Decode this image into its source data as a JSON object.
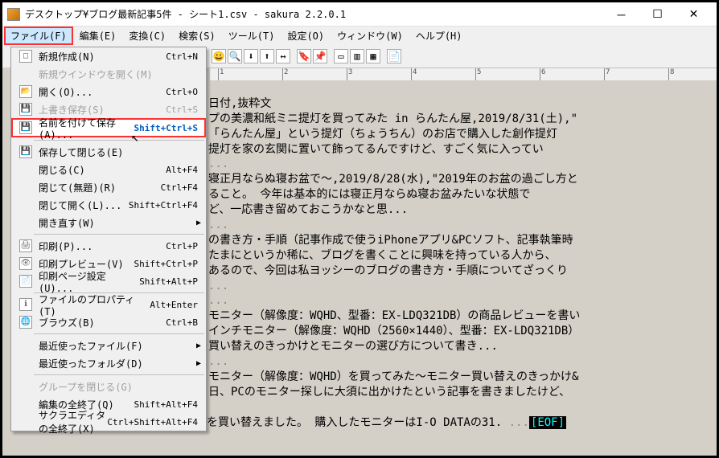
{
  "titlebar": {
    "text": "デスクトップ¥ブログ最新記事5件 - シート1.csv - sakura 2.2.0.1"
  },
  "menubar": {
    "file": "ファイル(F)",
    "edit": "編集(E)",
    "convert": "変換(C)",
    "search": "検索(S)",
    "tools": "ツール(T)",
    "settings": "設定(O)",
    "window": "ウィンドウ(W)",
    "help": "ヘルプ(H)"
  },
  "file_menu": {
    "new": {
      "label": "新規作成(N)",
      "shortcut": "Ctrl+N"
    },
    "new_window": {
      "label": "新規ウインドウを開く(M)"
    },
    "open": {
      "label": "開く(O)...",
      "shortcut": "Ctrl+O"
    },
    "save": {
      "label": "上書き保存(S)",
      "shortcut": "Ctrl+S"
    },
    "save_as": {
      "label": "名前を付けて保存(A)...",
      "shortcut": "Shift+Ctrl+S"
    },
    "save_close": {
      "label": "保存して閉じる(E)"
    },
    "close": {
      "label": "閉じる(C)",
      "shortcut": "Alt+F4"
    },
    "close_nosave": {
      "label": "閉じて(無題)(R)",
      "shortcut": "Ctrl+F4"
    },
    "close_open": {
      "label": "閉じて開く(L)...",
      "shortcut": "Shift+Ctrl+F4"
    },
    "reopen": {
      "label": "開き直す(W)"
    },
    "print": {
      "label": "印刷(P)...",
      "shortcut": "Ctrl+P"
    },
    "print_preview": {
      "label": "印刷プレビュー(V)",
      "shortcut": "Shift+Ctrl+P"
    },
    "page_setup": {
      "label": "印刷ページ設定(U)...",
      "shortcut": "Shift+Alt+P"
    },
    "properties": {
      "label": "ファイルのプロパティ(T)",
      "shortcut": "Alt+Enter"
    },
    "browse": {
      "label": "ブラウズ(B)",
      "shortcut": "Ctrl+B"
    },
    "recent_files": {
      "label": "最近使ったファイル(F)"
    },
    "recent_folders": {
      "label": "最近使ったフォルダ(D)"
    },
    "close_group": {
      "label": "グループを閉じる(G)"
    },
    "exit_editor": {
      "label": "編集の全終了(Q)",
      "shortcut": "Shift+Alt+F4"
    },
    "exit_all": {
      "label": "サクラエディタの全終了(X)",
      "shortcut": "Ctrl+Shift+Alt+F4"
    }
  },
  "editor_text": {
    "l1": "日付,抜粋文",
    "l2": "プの美濃和紙ミニ提灯を買ってみた in らんたん屋,2019/8/31(土),\"",
    "l3": "「らんたん屋」という提灯（ちょうちん）のお店で購入した創作提灯",
    "l4": "提灯を家の玄関に置いて飾ってるんですけど、すごく気に入ってい",
    "l5": "寝正月ならぬ寝お盆で～,2019/8/28(水),\"2019年のお盆の過ごし方と",
    "l6": "ること。 今年は基本的には寝正月ならぬ寝お盆みたいな状態で",
    "l7": "ど、一応書き留めておこうかなと思...",
    "l8": "の書き方・手順（記事作成で使うiPhoneアプリ&PCソフト、記事執筆時",
    "l9": "たまにというか稀に、ブログを書くことに興味を持っている人から、",
    "l10": "あるので、今回は私ヨッシーのブログの書き方・手順についてざっくり",
    "l11": "モニター（解像度：WQHD、型番：EX-LDQ321DB）の商品レビューを書い",
    "l12": "インチモニター（解像度：WQHD（2560×1440）、型番：EX-LDQ321DB）",
    "l13": "買い替えのきっかけとモニターの選び方について書き...",
    "l14": "モニター（解像度：WQHD）を買ってみた～モニター買い替えのきっかけ&",
    "l15": "日、PCのモニター探しに大須に出かけたという記事を書きましたけど、",
    "l16": "   約１０年ぶりにメインのモニターを買い替えました。 購入したモニターはI-O DATAの31.",
    "eof": "[EOF]"
  }
}
